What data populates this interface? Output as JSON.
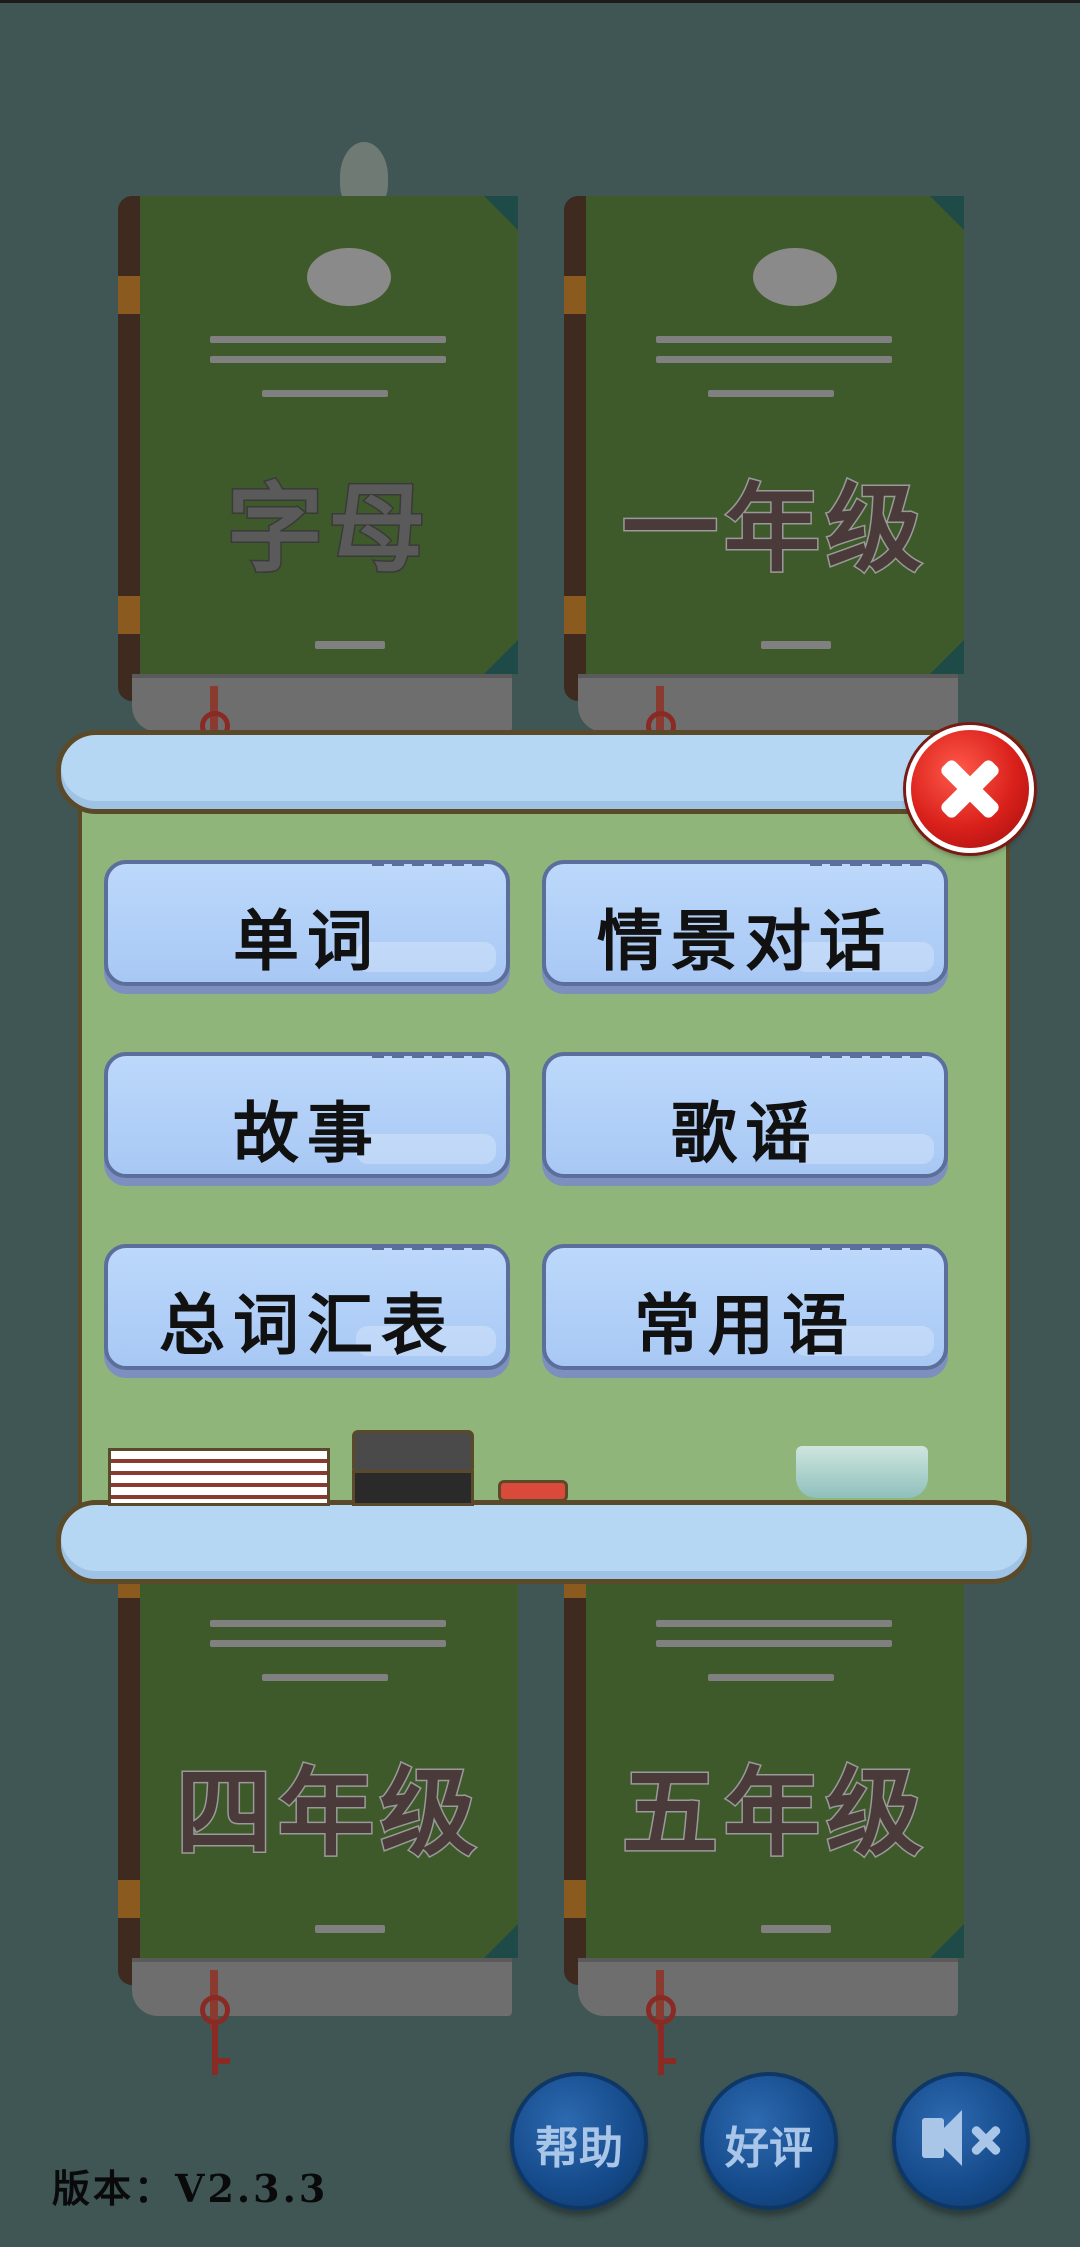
{
  "books": {
    "top_left": "字母",
    "top_right": "一年级",
    "bottom_left": "四年级",
    "bottom_right": "五年级"
  },
  "dialog": {
    "close_icon": "close-icon",
    "menu": {
      "words": "单词",
      "dialogues": "情景对话",
      "stories": "故事",
      "songs": "歌谣",
      "vocabulary": "总词汇表",
      "phrases": "常用语"
    }
  },
  "bottom_bar": {
    "help": "帮助",
    "rate": "好评",
    "mute_icon": "speaker-muted-icon"
  },
  "version": "版本：V2.3.3",
  "colors": {
    "background": "#3f5654",
    "book_cover": "#3f5a2a",
    "board": "#8fb57a",
    "menu_button": "#bcd8fb",
    "close_button": "#d9201b",
    "round_button": "#154a8a"
  }
}
